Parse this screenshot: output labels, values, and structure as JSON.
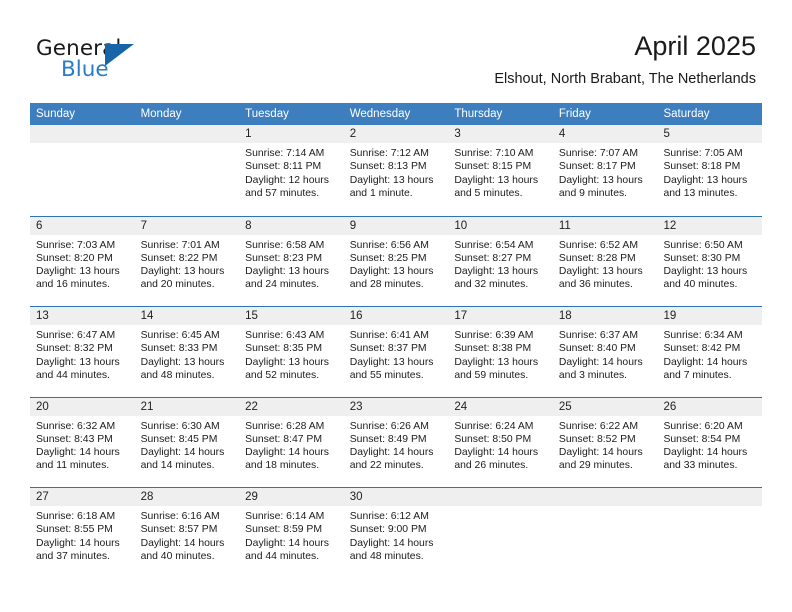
{
  "brand": {
    "name_top": "General",
    "name_bottom": "Blue",
    "triangle_color": "#1565a8",
    "blue_color": "#2b7cc4"
  },
  "header": {
    "title": "April 2025",
    "subtitle": "Elshout, North Brabant, The Netherlands"
  },
  "theme": {
    "header_blue": "#3d7ebf",
    "row_divider_blue": "#2f73b6",
    "day_band_gray": "#efefef"
  },
  "weekdays": [
    "Sunday",
    "Monday",
    "Tuesday",
    "Wednesday",
    "Thursday",
    "Friday",
    "Saturday"
  ],
  "weeks": [
    [
      {
        "day": "",
        "empty": true
      },
      {
        "day": "",
        "empty": true
      },
      {
        "day": "1",
        "sunrise": "Sunrise: 7:14 AM",
        "sunset": "Sunset: 8:11 PM",
        "daylight": "Daylight: 12 hours and 57 minutes."
      },
      {
        "day": "2",
        "sunrise": "Sunrise: 7:12 AM",
        "sunset": "Sunset: 8:13 PM",
        "daylight": "Daylight: 13 hours and 1 minute."
      },
      {
        "day": "3",
        "sunrise": "Sunrise: 7:10 AM",
        "sunset": "Sunset: 8:15 PM",
        "daylight": "Daylight: 13 hours and 5 minutes."
      },
      {
        "day": "4",
        "sunrise": "Sunrise: 7:07 AM",
        "sunset": "Sunset: 8:17 PM",
        "daylight": "Daylight: 13 hours and 9 minutes."
      },
      {
        "day": "5",
        "sunrise": "Sunrise: 7:05 AM",
        "sunset": "Sunset: 8:18 PM",
        "daylight": "Daylight: 13 hours and 13 minutes."
      }
    ],
    [
      {
        "day": "6",
        "sunrise": "Sunrise: 7:03 AM",
        "sunset": "Sunset: 8:20 PM",
        "daylight": "Daylight: 13 hours and 16 minutes."
      },
      {
        "day": "7",
        "sunrise": "Sunrise: 7:01 AM",
        "sunset": "Sunset: 8:22 PM",
        "daylight": "Daylight: 13 hours and 20 minutes."
      },
      {
        "day": "8",
        "sunrise": "Sunrise: 6:58 AM",
        "sunset": "Sunset: 8:23 PM",
        "daylight": "Daylight: 13 hours and 24 minutes."
      },
      {
        "day": "9",
        "sunrise": "Sunrise: 6:56 AM",
        "sunset": "Sunset: 8:25 PM",
        "daylight": "Daylight: 13 hours and 28 minutes."
      },
      {
        "day": "10",
        "sunrise": "Sunrise: 6:54 AM",
        "sunset": "Sunset: 8:27 PM",
        "daylight": "Daylight: 13 hours and 32 minutes."
      },
      {
        "day": "11",
        "sunrise": "Sunrise: 6:52 AM",
        "sunset": "Sunset: 8:28 PM",
        "daylight": "Daylight: 13 hours and 36 minutes."
      },
      {
        "day": "12",
        "sunrise": "Sunrise: 6:50 AM",
        "sunset": "Sunset: 8:30 PM",
        "daylight": "Daylight: 13 hours and 40 minutes."
      }
    ],
    [
      {
        "day": "13",
        "sunrise": "Sunrise: 6:47 AM",
        "sunset": "Sunset: 8:32 PM",
        "daylight": "Daylight: 13 hours and 44 minutes."
      },
      {
        "day": "14",
        "sunrise": "Sunrise: 6:45 AM",
        "sunset": "Sunset: 8:33 PM",
        "daylight": "Daylight: 13 hours and 48 minutes."
      },
      {
        "day": "15",
        "sunrise": "Sunrise: 6:43 AM",
        "sunset": "Sunset: 8:35 PM",
        "daylight": "Daylight: 13 hours and 52 minutes."
      },
      {
        "day": "16",
        "sunrise": "Sunrise: 6:41 AM",
        "sunset": "Sunset: 8:37 PM",
        "daylight": "Daylight: 13 hours and 55 minutes."
      },
      {
        "day": "17",
        "sunrise": "Sunrise: 6:39 AM",
        "sunset": "Sunset: 8:38 PM",
        "daylight": "Daylight: 13 hours and 59 minutes."
      },
      {
        "day": "18",
        "sunrise": "Sunrise: 6:37 AM",
        "sunset": "Sunset: 8:40 PM",
        "daylight": "Daylight: 14 hours and 3 minutes."
      },
      {
        "day": "19",
        "sunrise": "Sunrise: 6:34 AM",
        "sunset": "Sunset: 8:42 PM",
        "daylight": "Daylight: 14 hours and 7 minutes."
      }
    ],
    [
      {
        "day": "20",
        "sunrise": "Sunrise: 6:32 AM",
        "sunset": "Sunset: 8:43 PM",
        "daylight": "Daylight: 14 hours and 11 minutes."
      },
      {
        "day": "21",
        "sunrise": "Sunrise: 6:30 AM",
        "sunset": "Sunset: 8:45 PM",
        "daylight": "Daylight: 14 hours and 14 minutes."
      },
      {
        "day": "22",
        "sunrise": "Sunrise: 6:28 AM",
        "sunset": "Sunset: 8:47 PM",
        "daylight": "Daylight: 14 hours and 18 minutes."
      },
      {
        "day": "23",
        "sunrise": "Sunrise: 6:26 AM",
        "sunset": "Sunset: 8:49 PM",
        "daylight": "Daylight: 14 hours and 22 minutes."
      },
      {
        "day": "24",
        "sunrise": "Sunrise: 6:24 AM",
        "sunset": "Sunset: 8:50 PM",
        "daylight": "Daylight: 14 hours and 26 minutes."
      },
      {
        "day": "25",
        "sunrise": "Sunrise: 6:22 AM",
        "sunset": "Sunset: 8:52 PM",
        "daylight": "Daylight: 14 hours and 29 minutes."
      },
      {
        "day": "26",
        "sunrise": "Sunrise: 6:20 AM",
        "sunset": "Sunset: 8:54 PM",
        "daylight": "Daylight: 14 hours and 33 minutes."
      }
    ],
    [
      {
        "day": "27",
        "sunrise": "Sunrise: 6:18 AM",
        "sunset": "Sunset: 8:55 PM",
        "daylight": "Daylight: 14 hours and 37 minutes."
      },
      {
        "day": "28",
        "sunrise": "Sunrise: 6:16 AM",
        "sunset": "Sunset: 8:57 PM",
        "daylight": "Daylight: 14 hours and 40 minutes."
      },
      {
        "day": "29",
        "sunrise": "Sunrise: 6:14 AM",
        "sunset": "Sunset: 8:59 PM",
        "daylight": "Daylight: 14 hours and 44 minutes."
      },
      {
        "day": "30",
        "sunrise": "Sunrise: 6:12 AM",
        "sunset": "Sunset: 9:00 PM",
        "daylight": "Daylight: 14 hours and 48 minutes."
      },
      {
        "day": "",
        "empty": true
      },
      {
        "day": "",
        "empty": true
      },
      {
        "day": "",
        "empty": true
      }
    ]
  ]
}
